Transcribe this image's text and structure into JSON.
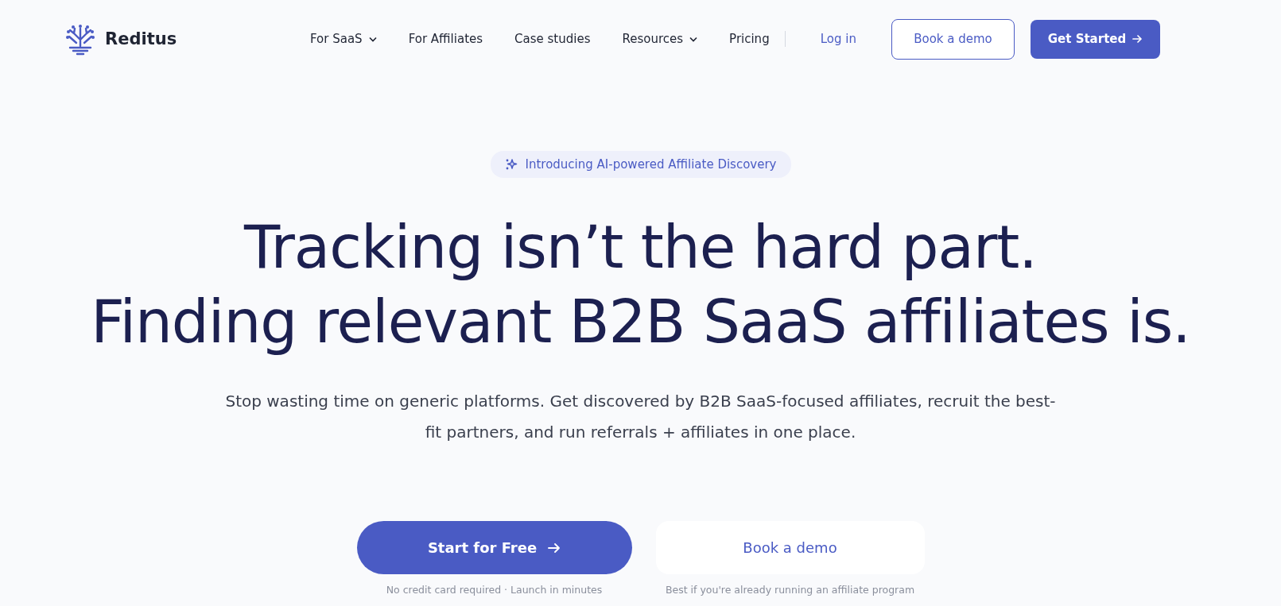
{
  "header": {
    "logo_text": "Reditus",
    "nav": [
      {
        "label": "For SaaS",
        "dropdown": true
      },
      {
        "label": "For Affiliates",
        "dropdown": false
      },
      {
        "label": "Case studies",
        "dropdown": false
      },
      {
        "label": "Resources",
        "dropdown": true
      },
      {
        "label": "Pricing",
        "dropdown": false
      }
    ],
    "login": "Log in",
    "demo": "Book a demo",
    "cta": "Get Started"
  },
  "hero": {
    "badge": "Introducing AI-powered Affiliate Discovery",
    "headline": [
      "Tracking isn’t the hard part.",
      "Finding relevant B2B SaaS affiliates is."
    ],
    "subtitle": "Stop wasting time on generic platforms. Get discovered by B2B SaaS-focused affiliates, recruit the best-fit partners, and run referrals + affiliates in one place.",
    "actions": [
      {
        "label": "Start for Free",
        "kind": "primary",
        "caption": "No credit card required · Launch in minutes"
      },
      {
        "label": "Book a demo",
        "kind": "secondary",
        "caption": "Best if you're already running an affiliate program"
      }
    ]
  }
}
